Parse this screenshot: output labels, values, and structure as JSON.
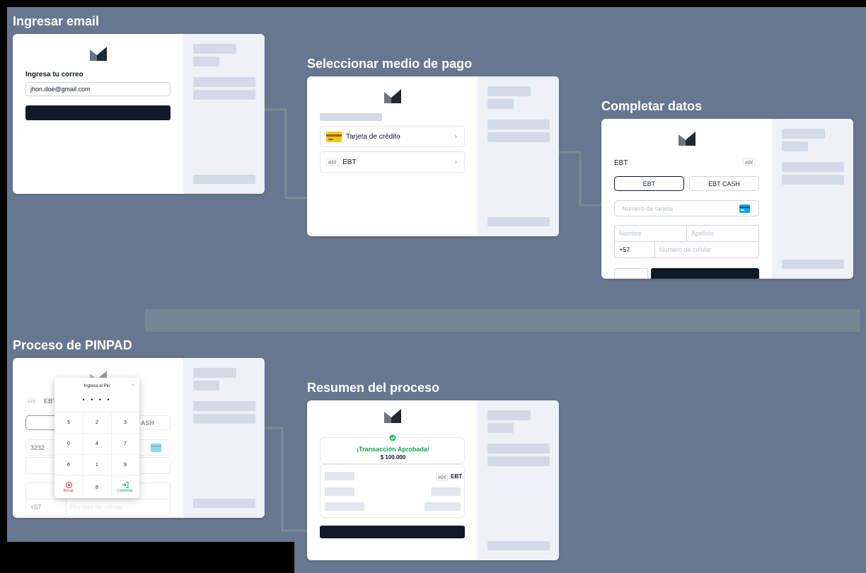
{
  "steps": {
    "email": {
      "title": "Ingresar email",
      "label": "Ingresa tu correo",
      "email_value": "jhon.doe@gmail.com"
    },
    "payment": {
      "title": "Seleccionar medio de pago",
      "options": [
        {
          "label": "Tarjeta de crédito",
          "icon": "credit-card-icon"
        },
        {
          "label": "EBT",
          "icon": "ebt-logo",
          "logo_text": "ebt"
        }
      ]
    },
    "details": {
      "title": "Completar datos",
      "method_label": "EBT",
      "logo_text": "ebt",
      "toggle_ebt": "EBT",
      "toggle_ebt_cash": "EBT CASH",
      "card_number_placeholder": "Numero de tarjeta",
      "first_name_placeholder": "Nombre",
      "last_name_placeholder": "Apellido",
      "phone_prefix": "+57",
      "phone_placeholder": "Numero de celular"
    },
    "pinpad": {
      "title": "Proceso de PINPAD",
      "modal_title": "Ingresa el Pin",
      "dots": "• • • •",
      "keys": [
        "5",
        "2",
        "3",
        "0",
        "4",
        "7",
        "6",
        "1",
        "9"
      ],
      "key_last": "8",
      "delete_label": "Borrar",
      "confirm_label": "Confirmar",
      "bg_card_partial": "3232",
      "bg_phone_prefix": "+57",
      "bg_phone_placeholder": "Numero de celular",
      "bg_ebt": "EBT",
      "bg_cash": "ASH"
    },
    "summary": {
      "title": "Resumen del proceso",
      "approved": "¡Transacción Aprobada!",
      "amount": "$ 100.000",
      "method": "EBT",
      "logo_text": "ebt"
    }
  },
  "colors": {
    "background": "#66778f",
    "card": "#ffffff",
    "sidebar": "#eef1f7",
    "skeleton": "#d4dae5",
    "primary_button": "#111827",
    "success": "#16a34a"
  }
}
